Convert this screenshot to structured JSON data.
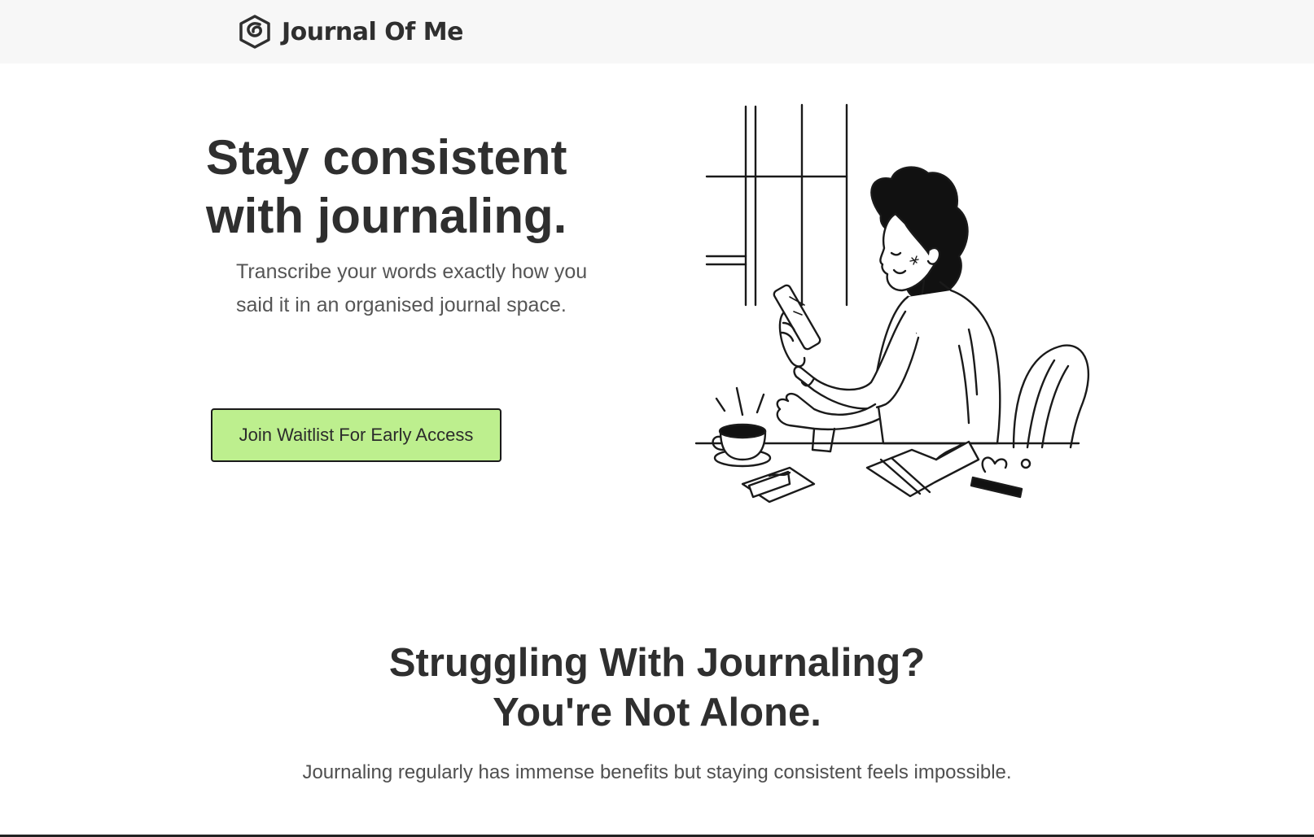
{
  "header": {
    "brand_name": "Journal Of Me",
    "logo_icon": "spiral-logo-icon"
  },
  "hero": {
    "title": "Stay consistent with journaling.",
    "subtitle": "Transcribe your words exactly how you said it in an organised journal space.",
    "cta_label": "Join Waitlist For Early Access",
    "illustration": "woman-journaling-illustration"
  },
  "section": {
    "title_line1": "Struggling With Journaling?",
    "title_line2": "You're Not Alone.",
    "subtitle": "Journaling regularly has immense benefits but staying consistent feels impossible."
  },
  "colors": {
    "header_bg": "#f7f7f7",
    "cta_bg": "#bdef8e",
    "text": "#2f2f2f",
    "muted_text": "#555555"
  }
}
